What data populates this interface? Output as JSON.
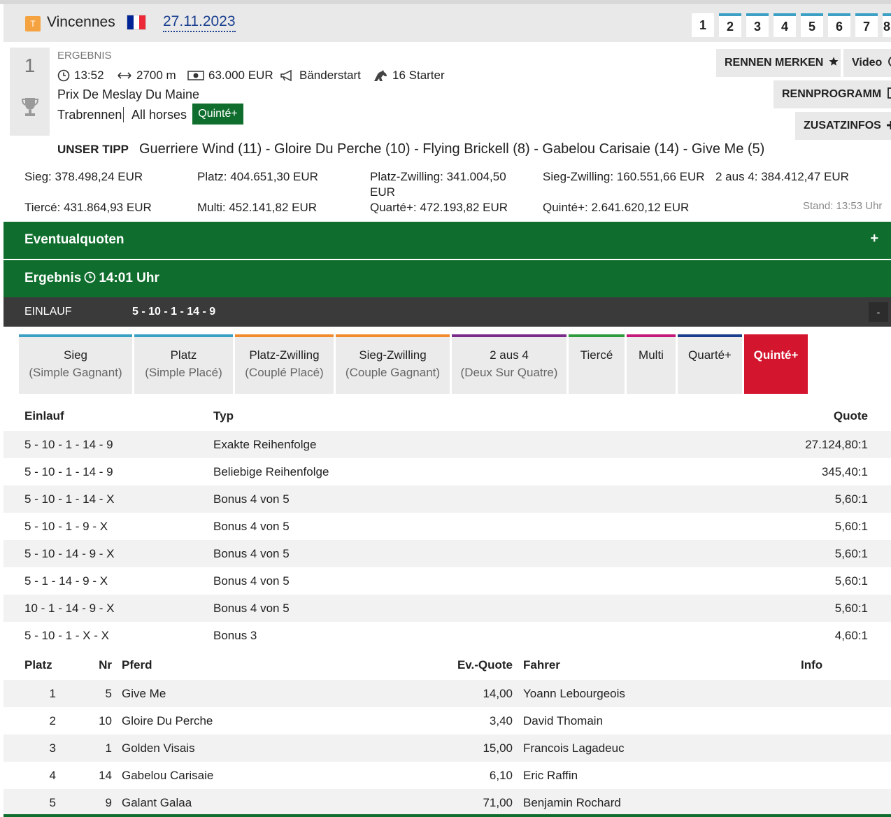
{
  "header": {
    "track_badge": "T",
    "track_name": "Vincennes",
    "date": "27.11.2023",
    "race_tabs": [
      "1",
      "2",
      "3",
      "4",
      "5",
      "6",
      "7",
      "8"
    ],
    "active_tab": "1",
    "flag_colors": [
      "#002395",
      "#ffffff",
      "#ed2939"
    ]
  },
  "race": {
    "number": "1",
    "status": "ERGEBNIS",
    "time": "13:52",
    "distance": "2700 m",
    "prize": "63.000 EUR",
    "start_type": "Bänderstart",
    "starters": "16 Starter",
    "name": "Prix De Meslay Du Maine",
    "type": "Trabrennen",
    "category": "All horses",
    "tag": "Quinté+"
  },
  "actions": {
    "bookmark": "RENNEN MERKEN",
    "video": "Video",
    "program": "RENNPROGRAMM",
    "extra": "ZUSATZINFOS"
  },
  "tipp": {
    "label": "UNSER TIPP",
    "text": "Guerriere Wind (11) - Gloire Du Perche (10) - Flying Brickell (8) - Gabelou Carisaie (14) - Give Me (5)"
  },
  "pools": {
    "sieg": "Sieg: 378.498,24 EUR",
    "platz": "Platz: 404.651,30 EUR",
    "platz_zwilling_1": "Platz-Zwilling: 341.004,50",
    "platz_zwilling_2": "EUR",
    "sieg_zwilling": "Sieg-Zwilling: 160.551,66 EUR",
    "zwei_aus_vier": "2 aus 4: 384.412,47 EUR",
    "tierce": "Tiercé: 431.864,93 EUR",
    "multi": "Multi: 452.141,82 EUR",
    "quarte": "Quarté+: 472.193,82 EUR",
    "quinte": "Quinté+: 2.641.620,12 EUR",
    "stand": "Stand: 13:53 Uhr"
  },
  "sections": {
    "eventual": "Eventualquoten",
    "eventual_toggle": "+",
    "ergebnis_label": "Ergebnis",
    "ergebnis_time": "14:01 Uhr"
  },
  "einlauf": {
    "label": "EINLAUF",
    "value": "5 - 10 - 1 - 14 - 9",
    "toggle": "-"
  },
  "bet_tabs": [
    {
      "l1": "Sieg",
      "l2": "(Simple Gagnant)",
      "color": "#3ba0c4"
    },
    {
      "l1": "Platz",
      "l2": "(Simple Placé)",
      "color": "#3ba0c4"
    },
    {
      "l1": "Platz-Zwilling",
      "l2": "(Couplé Placé)",
      "color": "#f28a2e"
    },
    {
      "l1": "Sieg-Zwilling",
      "l2": "(Couple Gagnant)",
      "color": "#f28a2e"
    },
    {
      "l1": "2 aus 4",
      "l2": "(Deux Sur Quatre)",
      "color": "#7b2c8a"
    },
    {
      "l1": "Tiercé",
      "l2": "",
      "color": "#2e9c3c"
    },
    {
      "l1": "Multi",
      "l2": "",
      "color": "#c4197a"
    },
    {
      "l1": "Quarté+",
      "l2": "",
      "color": "#1b3e8c"
    },
    {
      "l1": "Quinté+",
      "l2": "",
      "color": "#d4152e"
    }
  ],
  "quote_table": {
    "headers": {
      "einlauf": "Einlauf",
      "typ": "Typ",
      "quote": "Quote"
    },
    "rows": [
      {
        "einlauf": "5 - 10 - 1 - 14 - 9",
        "typ": "Exakte Reihenfolge",
        "quote": "27.124,80:1"
      },
      {
        "einlauf": "5 - 10 - 1 - 14 - 9",
        "typ": "Beliebige Reihenfolge",
        "quote": "345,40:1"
      },
      {
        "einlauf": "5 - 10 - 1 - 14 - X",
        "typ": "Bonus 4 von 5",
        "quote": "5,60:1"
      },
      {
        "einlauf": "5 - 10 - 1 - 9 - X",
        "typ": "Bonus 4 von 5",
        "quote": "5,60:1"
      },
      {
        "einlauf": "5 - 10 - 14 - 9 - X",
        "typ": "Bonus 4 von 5",
        "quote": "5,60:1"
      },
      {
        "einlauf": "5 - 1 - 14 - 9 - X",
        "typ": "Bonus 4 von 5",
        "quote": "5,60:1"
      },
      {
        "einlauf": "10 - 1 - 14 - 9 - X",
        "typ": "Bonus 4 von 5",
        "quote": "5,60:1"
      },
      {
        "einlauf": "5 - 10 - 1 - X - X",
        "typ": "Bonus 3",
        "quote": "4,60:1"
      }
    ]
  },
  "result_table": {
    "headers": {
      "platz": "Platz",
      "nr": "Nr",
      "pferd": "Pferd",
      "quote": "Ev.-Quote",
      "fahrer": "Fahrer",
      "info": "Info"
    },
    "rows": [
      {
        "platz": "1",
        "nr": "5",
        "pferd": "Give Me",
        "quote": "14,00",
        "fahrer": "Yoann Lebourgeois"
      },
      {
        "platz": "2",
        "nr": "10",
        "pferd": "Gloire Du Perche",
        "quote": "3,40",
        "fahrer": "David Thomain"
      },
      {
        "platz": "3",
        "nr": "1",
        "pferd": "Golden Visais",
        "quote": "15,00",
        "fahrer": "Francois Lagadeuc"
      },
      {
        "platz": "4",
        "nr": "14",
        "pferd": "Gabelou Carisaie",
        "quote": "6,10",
        "fahrer": "Eric Raffin"
      },
      {
        "platz": "5",
        "nr": "9",
        "pferd": "Galant Galaa",
        "quote": "71,00",
        "fahrer": "Benjamin Rochard"
      }
    ]
  }
}
